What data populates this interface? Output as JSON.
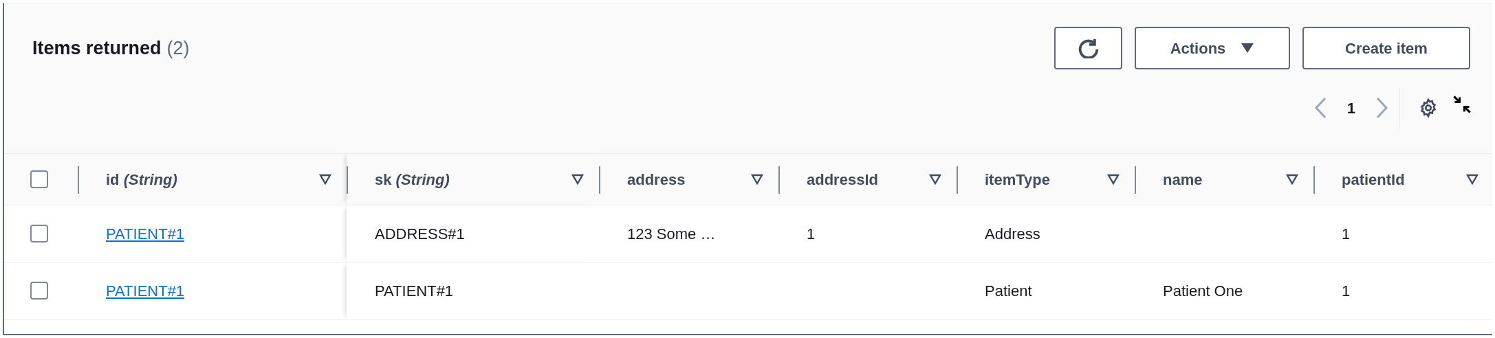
{
  "header": {
    "title": "Items returned",
    "count": "(2)"
  },
  "buttons": [
    {
      "kind": "refresh"
    },
    {
      "kind": "dropdown",
      "label": "Actions"
    },
    {
      "kind": "text",
      "label": "Create item"
    }
  ],
  "pagination": {
    "page": "1",
    "prev_disabled": true,
    "next_disabled": true
  },
  "table": {
    "select_all_checked": false,
    "columns": [
      {
        "label": "id *(String)*",
        "kind": "link"
      },
      {
        "label": "sk *(String)*",
        "kind": "text"
      },
      {
        "label": "address",
        "kind": "text"
      },
      {
        "label": "addressId",
        "kind": "text"
      },
      {
        "label": "itemType",
        "kind": "text"
      },
      {
        "label": "name",
        "kind": "text"
      },
      {
        "label": "patientId",
        "kind": "text"
      }
    ],
    "rows": [
      {
        "checked": false,
        "cells": [
          "PATIENT#1",
          "ADDRESS#1",
          "123 Some …",
          "1",
          "Address",
          null,
          "1"
        ]
      },
      {
        "checked": false,
        "cells": [
          "PATIENT#1",
          "PATIENT#1",
          null,
          null,
          "Patient",
          "Patient One",
          "1"
        ]
      }
    ]
  }
}
